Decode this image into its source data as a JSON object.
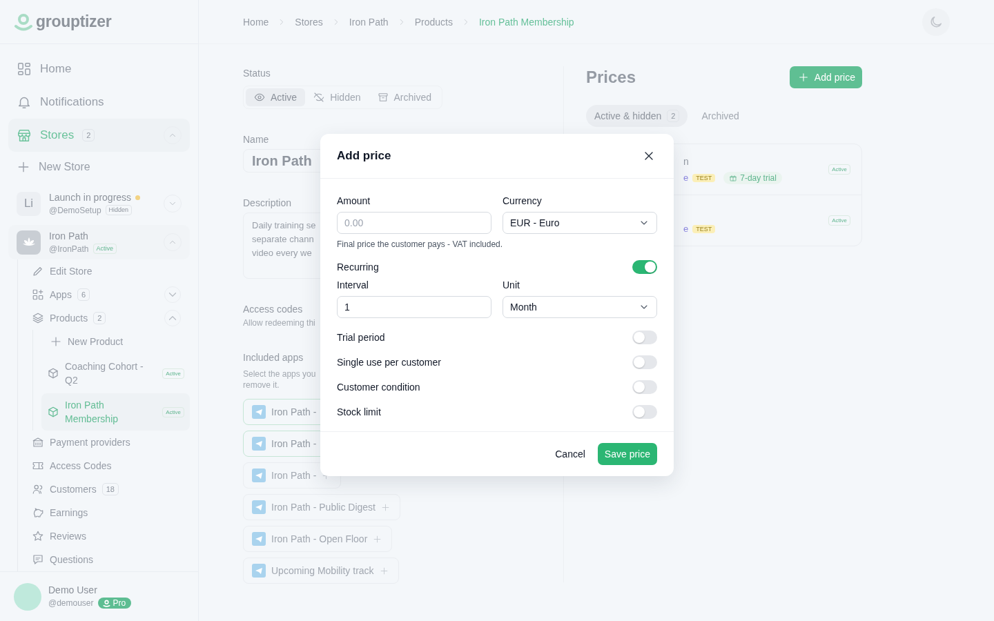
{
  "logo": {
    "text": "grouptizer"
  },
  "breadcrumbs": [
    {
      "label": "Home",
      "current": false
    },
    {
      "label": "Stores",
      "current": false
    },
    {
      "label": "Iron Path",
      "current": false
    },
    {
      "label": "Products",
      "current": false
    },
    {
      "label": "Iron Path Membership",
      "current": true
    }
  ],
  "sidebar": {
    "items": [
      {
        "kind": "nav",
        "label": "Home",
        "selected": false
      },
      {
        "kind": "nav",
        "label": "Notifications",
        "selected": false
      },
      {
        "kind": "section",
        "label": "Stores",
        "count": "2",
        "selected": true,
        "expanded": true,
        "children": [
          {
            "kind": "add",
            "label": "New Store"
          },
          {
            "kind": "store",
            "initials": "Li",
            "label": "Launch in progress",
            "pending": true,
            "handle": "@DemoSetup",
            "badge": "Hidden",
            "badge_active": false,
            "expanded": false
          },
          {
            "kind": "store",
            "label": "Iron Path",
            "pending": false,
            "handle": "@IronPath",
            "badge": "Active",
            "badge_active": true,
            "expanded": true,
            "children": [
              {
                "kind": "nav",
                "label": "Edit Store",
                "selected": false
              },
              {
                "kind": "group",
                "label": "Apps",
                "count": "6",
                "expanded": false
              },
              {
                "kind": "group",
                "label": "Products",
                "count": "2",
                "expanded": true,
                "children": [
                  {
                    "kind": "add",
                    "label": "New Product"
                  },
                  {
                    "kind": "product",
                    "label": "Coaching Cohort - Q2",
                    "badge": "Active",
                    "selected": false
                  },
                  {
                    "kind": "product",
                    "label": "Iron Path Membership",
                    "badge": "Active",
                    "selected": true
                  }
                ]
              },
              {
                "kind": "nav",
                "label": "Payment providers",
                "selected": false
              },
              {
                "kind": "nav",
                "label": "Access Codes",
                "selected": false
              },
              {
                "kind": "nav",
                "label": "Customers",
                "count": "18",
                "selected": false
              },
              {
                "kind": "nav",
                "label": "Earnings",
                "selected": false
              },
              {
                "kind": "nav",
                "label": "Reviews",
                "selected": false
              },
              {
                "kind": "nav",
                "label": "Questions",
                "selected": false
              }
            ]
          }
        ]
      }
    ],
    "user": {
      "name": "Demo User",
      "handle": "@demouser",
      "plan": "Pro"
    }
  },
  "product": {
    "status": {
      "label": "Status",
      "options": [
        {
          "label": "Active",
          "selected": true
        },
        {
          "label": "Hidden",
          "selected": false
        },
        {
          "label": "Archived",
          "selected": false
        }
      ]
    },
    "name": {
      "label": "Name",
      "value": "Iron Path"
    },
    "description": {
      "label": "Description",
      "lines": [
        "Daily training se",
        "separate chann",
        "video every we"
      ]
    },
    "access_codes": {
      "title": "Access codes",
      "hint": "Allow redeeming thi"
    },
    "included_apps": {
      "title": "Included apps",
      "hint_lines": [
        "Select the apps you",
        "remove it."
      ],
      "apps": [
        {
          "label": "Iron Path -",
          "included": true
        },
        {
          "label": "Iron Path -",
          "included": true
        },
        {
          "label": "Iron Path -",
          "included": false
        },
        {
          "label": "Iron Path - Public Digest",
          "included": false
        },
        {
          "label": "Iron Path - Open Floor",
          "included": false
        },
        {
          "label": "Upcoming Mobility track",
          "included": false
        }
      ]
    }
  },
  "prices": {
    "title": "Prices",
    "add_button": "Add price",
    "tabs": [
      {
        "label": "Active & hidden",
        "count": "2",
        "selected": true
      },
      {
        "label": "Archived",
        "selected": false
      }
    ],
    "rows": [
      {
        "title": "n",
        "mode": "e",
        "env": "TEST",
        "trial": "7-day trial",
        "status": "Active"
      },
      {
        "mode": "e",
        "env": "TEST",
        "status": "Active"
      }
    ]
  },
  "dialog": {
    "title": "Add price",
    "amount": {
      "label": "Amount",
      "placeholder": "0.00"
    },
    "currency": {
      "label": "Currency",
      "value": "EUR - Euro"
    },
    "amount_hint": "Final price the customer pays - VAT included.",
    "recurring": {
      "label": "Recurring",
      "on": true
    },
    "interval": {
      "label": "Interval",
      "value": "1"
    },
    "unit": {
      "label": "Unit",
      "value": "Month"
    },
    "options": [
      {
        "label": "Trial period",
        "on": false
      },
      {
        "label": "Single use per customer",
        "on": false
      },
      {
        "label": "Customer condition",
        "on": false
      },
      {
        "label": "Stock limit",
        "on": false
      }
    ],
    "cancel": "Cancel",
    "save": "Save price"
  }
}
